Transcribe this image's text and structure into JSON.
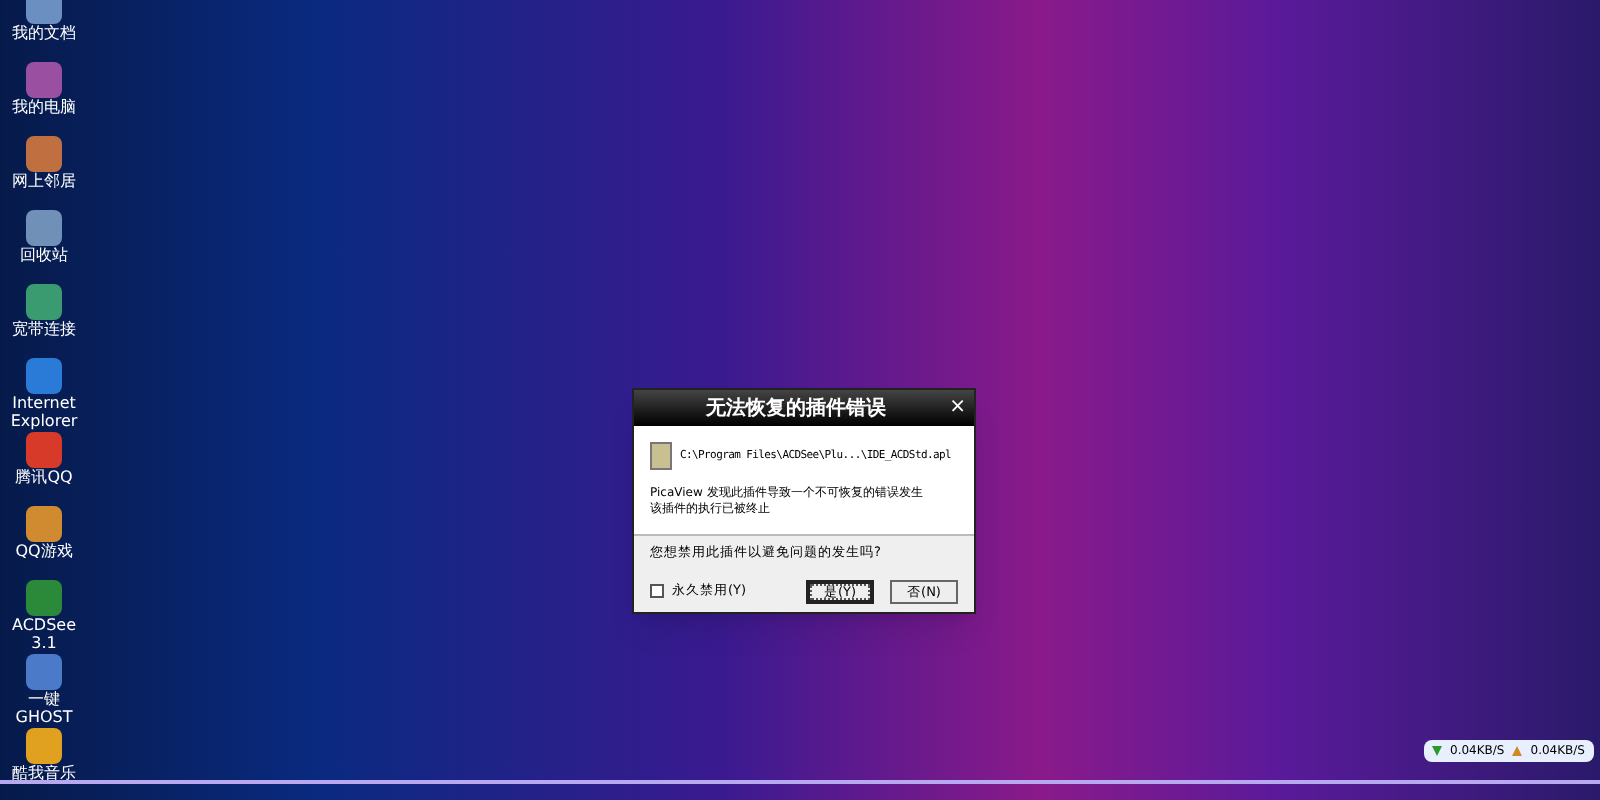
{
  "desktop_icons": [
    {
      "label": "我的文档",
      "color": "#6a8fc0"
    },
    {
      "label": "我的电脑",
      "color": "#9a4fa0"
    },
    {
      "label": "网上邻居",
      "color": "#c07040"
    },
    {
      "label": "回收站",
      "color": "#7090b8"
    },
    {
      "label": "宽带连接",
      "color": "#3a9a70"
    },
    {
      "label": "Internet Explorer",
      "color": "#2a7ad8"
    },
    {
      "label": "腾讯QQ",
      "color": "#d83a2a"
    },
    {
      "label": "QQ游戏",
      "color": "#d08a30"
    },
    {
      "label": "ACDSee 3.1",
      "color": "#2a8a3a"
    },
    {
      "label": "一键GHOST",
      "color": "#4a7ac8"
    },
    {
      "label": "酷我音乐",
      "color": "#e0a020"
    }
  ],
  "dialog": {
    "title": "无法恢复的插件错误",
    "close": "×",
    "path": "C:\\Program Files\\ACDSee\\Plu...\\IDE_ACDStd.apl",
    "message": [
      "PicaView 发现此插件导致一个不可恢复的错误发生",
      "该插件的执行已被终止"
    ],
    "question": "您想禁用此插件以避免问题的发生吗?",
    "checkbox": {
      "label": "永久禁用(Y)",
      "checked": false
    },
    "buttons": [
      {
        "label": "是(Y)",
        "selected": true
      },
      {
        "label": "否(N)",
        "selected": false
      }
    ]
  },
  "net_speed": {
    "down": "0.04KB/S",
    "up": "0.04KB/S"
  }
}
